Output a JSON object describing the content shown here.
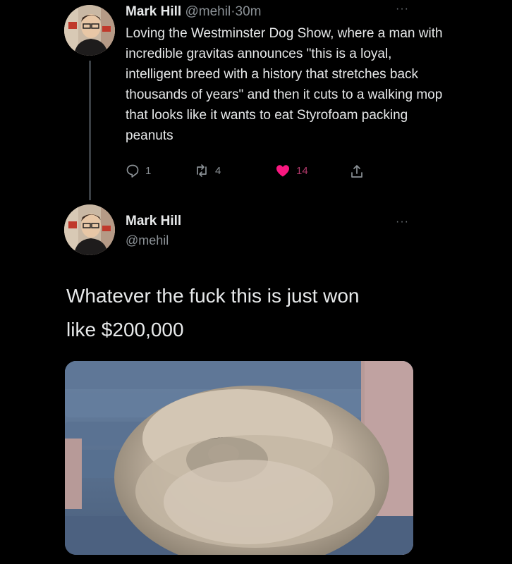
{
  "tweet1": {
    "name": "Mark Hill",
    "handle": "@mehil",
    "separator": "·",
    "time": "30m",
    "text": "Loving the Westminster Dog Show, where a man with incredible gravitas announces \"this is a loyal, intelligent breed with a history that stretches back thousands of years\" and then it cuts to a walking mop that looks like it wants to eat Styrofoam packing peanuts",
    "more": "···",
    "actions": {
      "replies": "1",
      "retweets": "4",
      "likes": "14"
    }
  },
  "tweet2": {
    "name": "Mark Hill",
    "handle": "@mehil",
    "more": "···",
    "text_line1": "Whatever the fuck this is just won",
    "text_line2": "like $200,000",
    "media": "photo of a fluffy Pekingese dog on a blue couch"
  },
  "colors": {
    "background": "#000000",
    "text": "#e7e9ea",
    "muted": "#8b9196",
    "like": "#f91880"
  },
  "icons": [
    "reply-icon",
    "retweet-icon",
    "heart-icon",
    "share-icon",
    "more-icon"
  ]
}
